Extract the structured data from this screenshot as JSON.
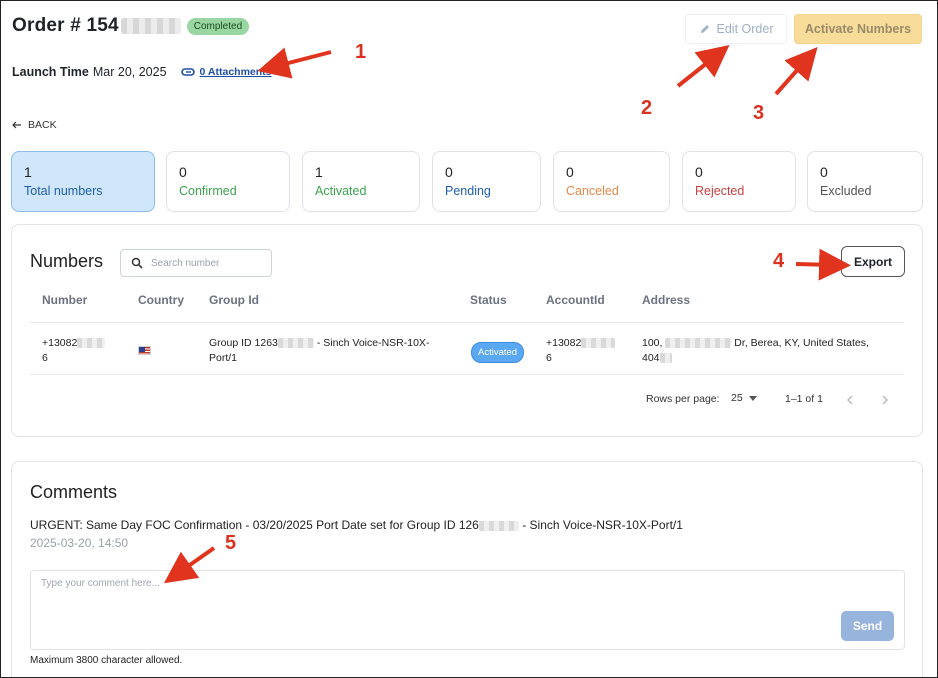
{
  "header": {
    "order_prefix": "Order # 154",
    "status_badge": "Completed",
    "launch_label": "Launch Time",
    "launch_value": "Mar 20, 2025",
    "attachments_label": "0 Attachments",
    "edit_label": "Edit Order",
    "activate_label": "Activate Numbers",
    "back_label": "BACK"
  },
  "stats": [
    {
      "count": "1",
      "label": "Total numbers",
      "color": "#1f5fae"
    },
    {
      "count": "0",
      "label": "Confirmed",
      "color": "#3ea34f"
    },
    {
      "count": "1",
      "label": "Activated",
      "color": "#3ea34f"
    },
    {
      "count": "0",
      "label": "Pending",
      "color": "#1f5fae"
    },
    {
      "count": "0",
      "label": "Canceled",
      "color": "#e58a4a"
    },
    {
      "count": "0",
      "label": "Rejected",
      "color": "#c94242"
    },
    {
      "count": "0",
      "label": "Excluded",
      "color": "#555555"
    }
  ],
  "numbers": {
    "title": "Numbers",
    "search_placeholder": "Search number",
    "export_label": "Export",
    "columns": [
      "Number",
      "Country",
      "Group Id",
      "Status",
      "AccountId",
      "Address"
    ],
    "row": {
      "number_prefix": "+13082",
      "number_suffix": "6",
      "group_prefix": "Group ID 1263",
      "group_suffix": "- Sinch Voice-NSR-10X-",
      "group_line2": "Port/1",
      "status": "Activated",
      "account_prefix": "+13082",
      "account_suffix": "6",
      "address_prefix": "100,",
      "address_suffix": "Dr, Berea, KY, United States,",
      "address_line2": "404"
    },
    "rows_per_page_label": "Rows per page:",
    "rows_per_page_value": "25",
    "page_range": "1–1 of 1"
  },
  "comments": {
    "title": "Comments",
    "comment_prefix": "URGENT: Same Day FOC Confirmation - 03/20/2025 Port Date set for Group ID 126",
    "comment_suffix": "- Sinch Voice-NSR-10X-Port/1",
    "comment_date": "2025-03-20, 14:50",
    "placeholder": "Type your comment here...",
    "send_label": "Send",
    "max_note": "Maximum 3800 character allowed."
  },
  "annotations": [
    "1",
    "2",
    "3",
    "4",
    "5"
  ]
}
